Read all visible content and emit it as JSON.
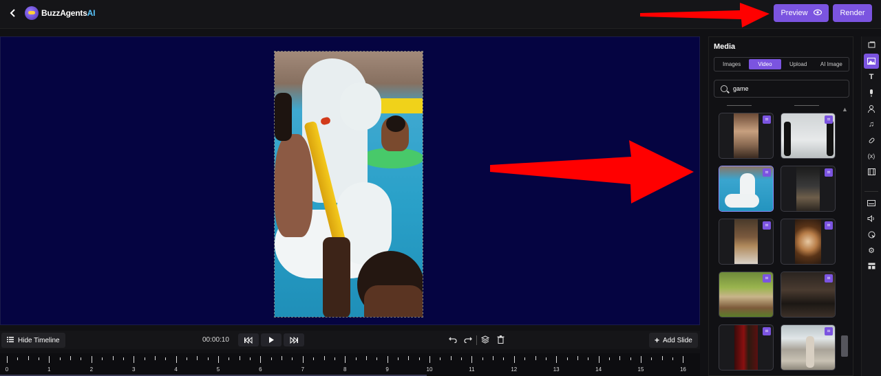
{
  "header": {
    "logo_text": "BuzzAgents",
    "logo_accent": "AI",
    "preview_label": "Preview",
    "render_label": "Render"
  },
  "timeline": {
    "hide_label": "Hide Timeline",
    "time": "00:00:10",
    "add_slide_label": "Add Slide",
    "ruler_labels": [
      "0",
      "1",
      "2",
      "3",
      "4",
      "5",
      "6",
      "7",
      "8",
      "9",
      "10",
      "11",
      "12",
      "13",
      "14",
      "15",
      "16"
    ]
  },
  "media": {
    "title": "Media",
    "tabs": [
      "Images",
      "Video",
      "Upload",
      "AI Image"
    ],
    "active_tab": "Video",
    "search_value": "game",
    "thumbnails": [
      {
        "name": "chess-player",
        "selected": false
      },
      {
        "name": "chess-pieces",
        "selected": false
      },
      {
        "name": "pool-party",
        "selected": true
      },
      {
        "name": "chess-board-dark",
        "selected": false
      },
      {
        "name": "man-with-trophy",
        "selected": false
      },
      {
        "name": "roulette-wheel",
        "selected": false
      },
      {
        "name": "outdoor-game",
        "selected": false
      },
      {
        "name": "group-playing",
        "selected": false
      },
      {
        "name": "theater-curtain",
        "selected": false
      },
      {
        "name": "stadium-walk",
        "selected": false
      }
    ]
  },
  "rail": {
    "icons": [
      "template-icon",
      "image-icon",
      "text-icon",
      "microphone-icon",
      "avatar-icon",
      "music-icon",
      "sticker-icon",
      "variable-icon",
      "film-icon",
      "subtitles-icon",
      "volume-icon",
      "cursor-icon",
      "settings-icon",
      "layout-icon"
    ],
    "active_icon": "image-icon"
  },
  "colors": {
    "accent": "#7b54e0",
    "canvas_bg": "#050441",
    "annotation_arrow": "#ff0000"
  }
}
